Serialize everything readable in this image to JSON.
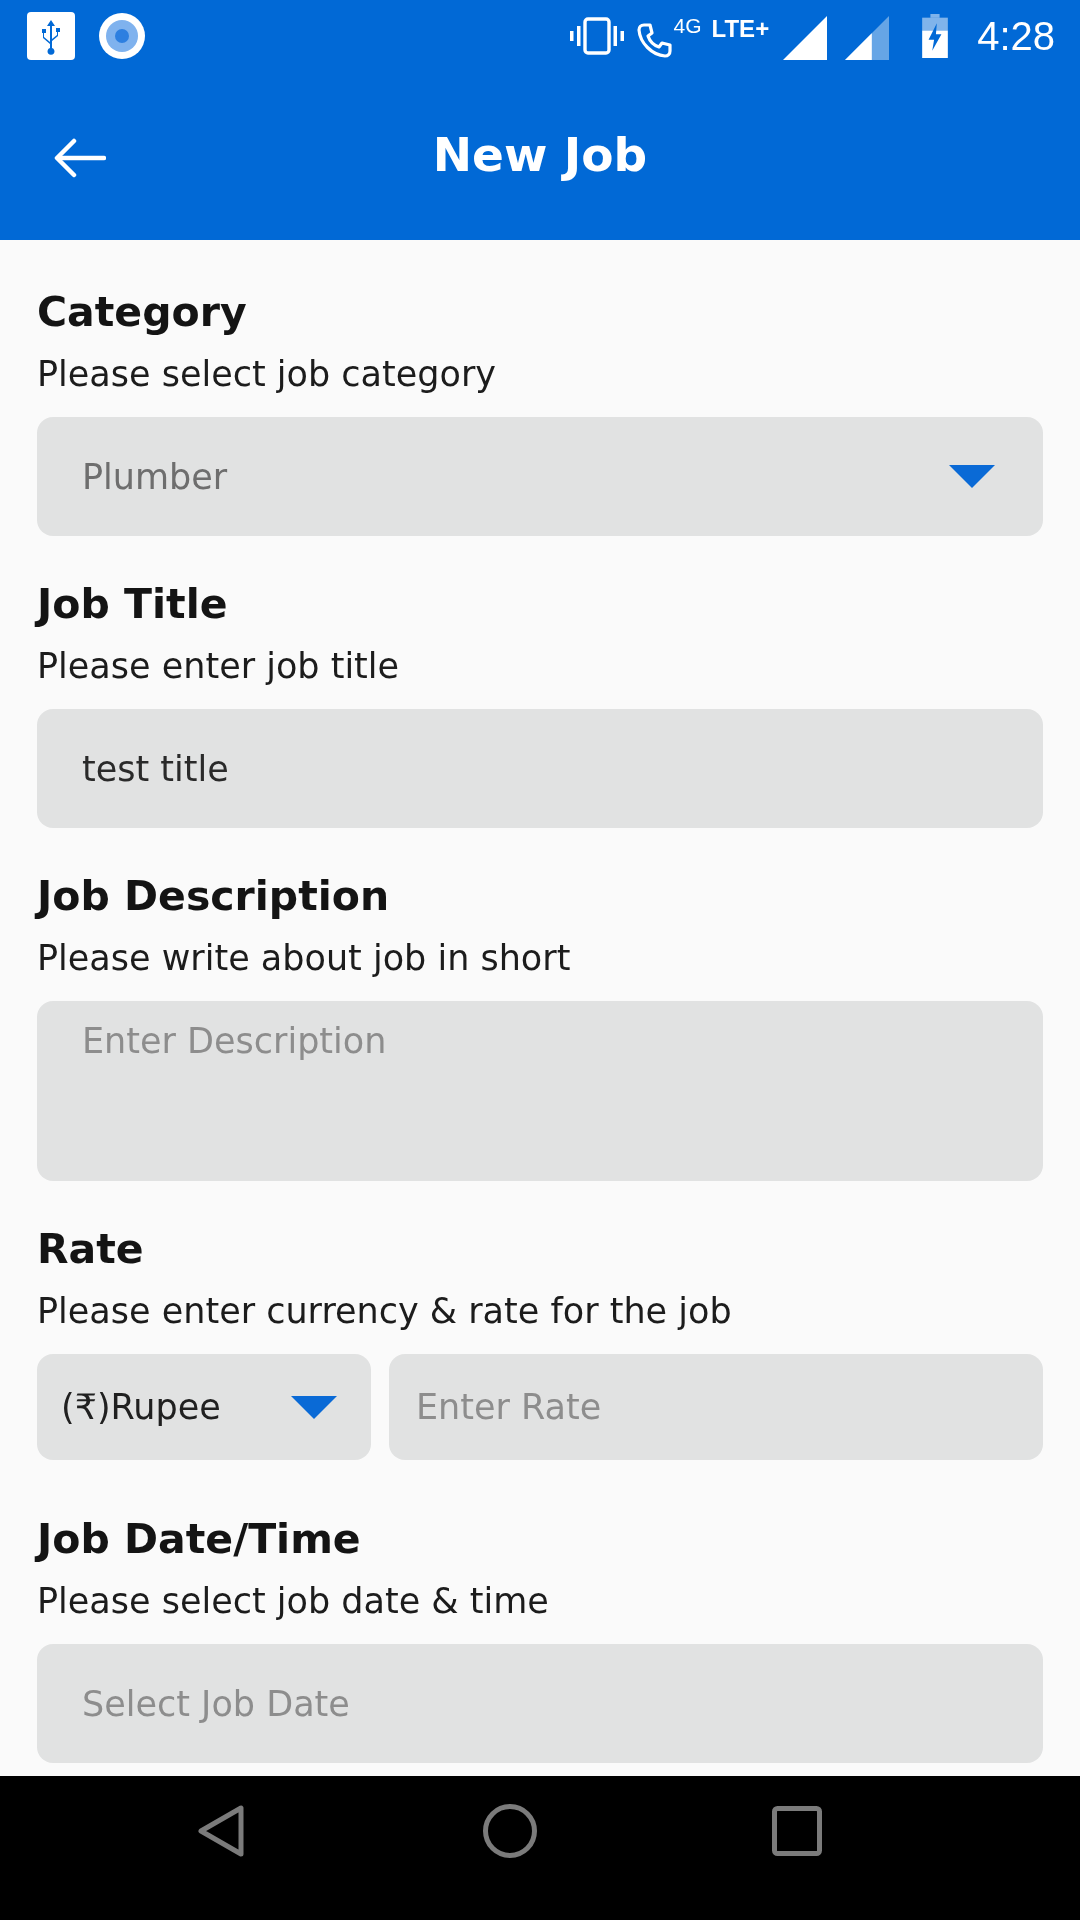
{
  "status_bar": {
    "network_label": "4G",
    "network_type": "LTE+",
    "time": "4:28"
  },
  "app_bar": {
    "title": "New Job"
  },
  "sections": [
    {
      "kind": "dropdown",
      "title": "Category",
      "subtitle": "Please select job category",
      "value": "Plumber"
    },
    {
      "kind": "input",
      "title": "Job Title",
      "subtitle": "Please enter job title",
      "value": "test title"
    },
    {
      "kind": "textarea",
      "title": "Job Description",
      "subtitle": "Please write about job in short",
      "placeholder": "Enter Description"
    },
    {
      "kind": "currency_rate",
      "title": "Rate",
      "subtitle": "Please enter currency & rate for the job",
      "currency": "(₹)Rupee",
      "placeholder": "Enter Rate"
    },
    {
      "kind": "date",
      "title": "Job Date/Time",
      "subtitle": "Please select job date & time",
      "placeholder": "Select Job Date"
    }
  ]
}
